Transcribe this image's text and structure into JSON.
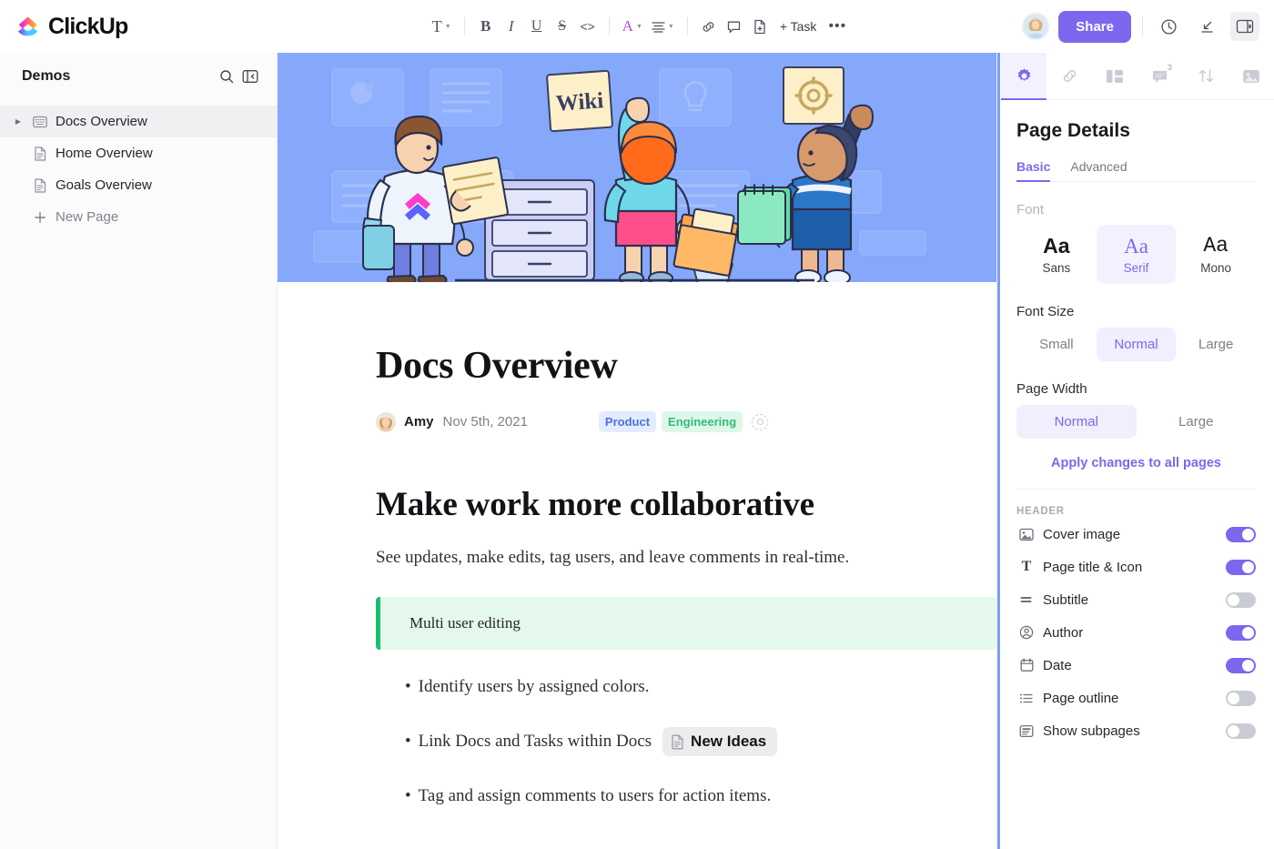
{
  "brand": {
    "name": "ClickUp",
    "mark": "clickup-logo-icon"
  },
  "toolbar": {
    "items": [
      {
        "name": "text-style-button",
        "glyph": "T",
        "caret": true
      },
      {
        "name": "bold-button",
        "glyph": "B"
      },
      {
        "name": "italic-button",
        "glyph": "I"
      },
      {
        "name": "underline-button",
        "glyph": "U"
      },
      {
        "name": "strikethrough-button",
        "glyph": "S"
      },
      {
        "name": "code-button",
        "glyph": "<>"
      },
      {
        "name": "text-color-button",
        "glyph": "A",
        "caret": true
      },
      {
        "name": "align-button",
        "glyph": "align",
        "caret": true
      },
      {
        "name": "link-button",
        "glyph": "link"
      },
      {
        "name": "comment-button",
        "glyph": "comment"
      },
      {
        "name": "page-button",
        "glyph": "page"
      },
      {
        "name": "add-task-button",
        "glyph": "+ Task"
      },
      {
        "name": "more-options-button",
        "glyph": "..."
      }
    ],
    "task_label": "+ Task",
    "more_label": "•••"
  },
  "topright": {
    "share_label": "Share",
    "avatar": "user-avatar",
    "history_icon": "history-clock-icon",
    "import_icon": "download-arrow-icon",
    "panel_icon": "toggle-right-panel-icon"
  },
  "sidebar": {
    "title": "Demos",
    "search_icon": "search-icon",
    "collapse_icon": "collapse-sidebar-icon",
    "items": [
      {
        "label": "Docs Overview",
        "icon": "docs-book-icon",
        "active": true,
        "expandable": true
      },
      {
        "label": "Home Overview",
        "icon": "page-icon",
        "active": false,
        "expandable": false
      },
      {
        "label": "Goals Overview",
        "icon": "page-icon",
        "active": false,
        "expandable": false
      },
      {
        "label": "New Page",
        "icon": "plus-icon",
        "active": false,
        "expandable": false,
        "muted": true
      }
    ]
  },
  "document": {
    "cover_alt": "team-wiki-illustration",
    "cover_bg": "#85a8fb",
    "title": "Docs Overview",
    "author": "Amy",
    "date": "Nov 5th, 2021",
    "tags": [
      {
        "label": "Product",
        "bg": "#e4ebfd",
        "color": "#4a73d8"
      },
      {
        "label": "Engineering",
        "bg": "#ddf7e9",
        "color": "#37ba77"
      }
    ],
    "add_tag_icon": "add-tag-icon",
    "heading": "Make work more collaborative",
    "paragraph": "See updates, make edits, tag users, and leave comments in real-time.",
    "callout": {
      "text": "Multi user editing",
      "bg": "#e5f8ee",
      "border": "#18bf71"
    },
    "bullets": [
      {
        "text": "Identify users by assigned colors."
      },
      {
        "text": "Link Docs and Tasks within Docs",
        "chip": {
          "label": "New Ideas",
          "icon": "page-icon"
        }
      },
      {
        "text": "Tag and assign comments to users for action items."
      }
    ],
    "bullet_dot": "•"
  },
  "panel": {
    "tabs": [
      {
        "name": "settings-tab",
        "icon": "gear-icon",
        "active": true,
        "badge": ""
      },
      {
        "name": "relationships-tab",
        "icon": "link-chain-icon",
        "active": false,
        "badge": ""
      },
      {
        "name": "templates-tab",
        "icon": "layout-icon",
        "active": false,
        "badge": ""
      },
      {
        "name": "comments-tab",
        "icon": "comment-icon",
        "active": false,
        "badge": "3"
      },
      {
        "name": "sort-tab",
        "icon": "sort-arrows-icon",
        "active": false,
        "badge": ""
      },
      {
        "name": "cover-tab",
        "icon": "image-icon",
        "active": false,
        "badge": ""
      }
    ],
    "title": "Page Details",
    "subtabs": [
      {
        "label": "Basic",
        "active": true
      },
      {
        "label": "Advanced",
        "active": false
      }
    ],
    "font_label": "Font",
    "font_options": [
      {
        "sample": "Aa",
        "label": "Sans",
        "selected": false,
        "style": "sans"
      },
      {
        "sample": "Aa",
        "label": "Serif",
        "selected": true,
        "style": "serif"
      },
      {
        "sample": "Aa",
        "label": "Mono",
        "selected": false,
        "style": "mono"
      }
    ],
    "font_size_label": "Font Size",
    "font_sizes": [
      {
        "label": "Small",
        "selected": false
      },
      {
        "label": "Normal",
        "selected": true
      },
      {
        "label": "Large",
        "selected": false
      }
    ],
    "page_width_label": "Page Width",
    "page_widths": [
      {
        "label": "Normal",
        "selected": true
      },
      {
        "label": "Large",
        "selected": false
      }
    ],
    "apply_label": "Apply changes to all pages",
    "header_group_label": "HEADER",
    "header_toggles": [
      {
        "label": "Cover image",
        "icon": "image-icon",
        "on": true
      },
      {
        "label": "Page title & Icon",
        "icon": "text-t-icon",
        "on": true
      },
      {
        "label": "Subtitle",
        "icon": "subtitle-icon",
        "on": false
      },
      {
        "label": "Author",
        "icon": "user-circle-icon",
        "on": true
      },
      {
        "label": "Date",
        "icon": "calendar-icon",
        "on": true
      },
      {
        "label": "Page outline",
        "icon": "list-outline-icon",
        "on": false
      },
      {
        "label": "Show subpages",
        "icon": "subpages-icon",
        "on": false
      }
    ]
  },
  "colors": {
    "accent": "#7b68ee",
    "toggle_off": "#c9ccd2",
    "cover": "#85a8fb"
  },
  "cursor": {
    "name": "mouse-pointer"
  }
}
